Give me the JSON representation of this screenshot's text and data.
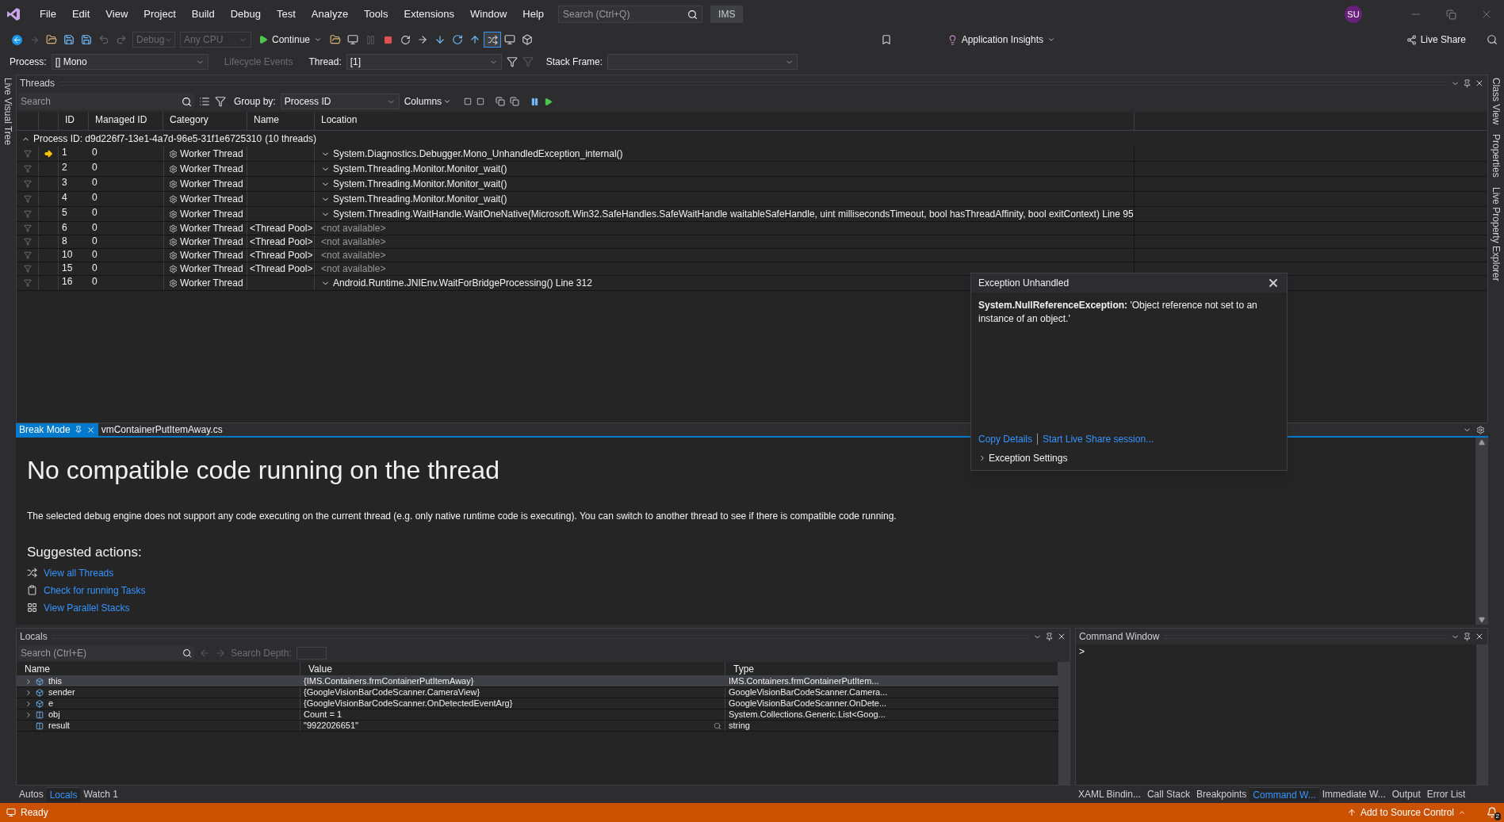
{
  "menu": {
    "items": [
      "File",
      "Edit",
      "View",
      "Project",
      "Build",
      "Debug",
      "Test",
      "Analyze",
      "Tools",
      "Extensions",
      "Window",
      "Help"
    ],
    "search_placeholder": "Search (Ctrl+Q)",
    "solution": "IMS",
    "user_initials": "SU"
  },
  "toolbar": {
    "configuration": "Debug",
    "platform": "Any CPU",
    "continue": "Continue",
    "app_insights": "Application Insights",
    "live_share": "Live Share"
  },
  "debug_location": {
    "process_label": "Process:",
    "process": "[] Mono",
    "lifecycle": "Lifecycle Events",
    "thread_label": "Thread:",
    "thread": "[1]",
    "stack_label": "Stack Frame:"
  },
  "left_strip": [
    "Live Visual Tree"
  ],
  "right_strip": [
    "Class View",
    "Properties",
    "Live Property Explorer"
  ],
  "threads": {
    "title": "Threads",
    "search_placeholder": "Search",
    "group_by_label": "Group by:",
    "group_by": "Process ID",
    "columns_label": "Columns",
    "headers": [
      "ID",
      "Managed ID",
      "Category",
      "Name",
      "Location"
    ],
    "group": {
      "label": "Process ID: d9d226f7-13e1-4a7d-96e5-31f1e6725310",
      "count": "(10 threads)",
      "expanded": true
    },
    "rows": [
      {
        "id": "1",
        "managed_id": "0",
        "category": "Worker Thread",
        "name": "",
        "location": "System.Diagnostics.Debugger.Mono_UnhandledException_internal()",
        "kind": "frame",
        "current": true
      },
      {
        "id": "2",
        "managed_id": "0",
        "category": "Worker Thread",
        "name": "",
        "location": "System.Threading.Monitor.Monitor_wait()",
        "kind": "frame",
        "current": false
      },
      {
        "id": "3",
        "managed_id": "0",
        "category": "Worker Thread",
        "name": "",
        "location": "System.Threading.Monitor.Monitor_wait()",
        "kind": "frame",
        "current": false
      },
      {
        "id": "4",
        "managed_id": "0",
        "category": "Worker Thread",
        "name": "",
        "location": "System.Threading.Monitor.Monitor_wait()",
        "kind": "frame",
        "current": false
      },
      {
        "id": "5",
        "managed_id": "0",
        "category": "Worker Thread",
        "name": "",
        "location": "System.Threading.WaitHandle.WaitOneNative(Microsoft.Win32.SafeHandles.SafeWaitHandle waitableSafeHandle, uint millisecondsTimeout, bool hasThreadAffinity, bool exitContext) Line 95",
        "kind": "frame",
        "current": false
      },
      {
        "id": "6",
        "managed_id": "0",
        "category": "Worker Thread",
        "name": "<Thread Pool>",
        "location": "<not available>",
        "kind": "unavailable",
        "current": false
      },
      {
        "id": "8",
        "managed_id": "0",
        "category": "Worker Thread",
        "name": "<Thread Pool>",
        "location": "<not available>",
        "kind": "unavailable",
        "current": false
      },
      {
        "id": "10",
        "managed_id": "0",
        "category": "Worker Thread",
        "name": "<Thread Pool>",
        "location": "<not available>",
        "kind": "unavailable",
        "current": false
      },
      {
        "id": "15",
        "managed_id": "0",
        "category": "Worker Thread",
        "name": "<Thread Pool>",
        "location": "<not available>",
        "kind": "unavailable",
        "current": false
      },
      {
        "id": "16",
        "managed_id": "0",
        "category": "Worker Thread",
        "name": "",
        "location": "Android.Runtime.JNIEnv.WaitForBridgeProcessing() Line 312",
        "kind": "frame",
        "current": false
      }
    ]
  },
  "exception": {
    "title": "Exception Unhandled",
    "message": "**System.NullReferenceException:** 'Object reference not set to an instance of an object.'",
    "links": [
      "Copy Details",
      "Start Live Share session..."
    ],
    "settings": "Exception Settings"
  },
  "document_tabs": [
    {
      "label": "Break Mode",
      "selected": true
    },
    {
      "label": "vmContainerPutItemAway.cs",
      "selected": false
    }
  ],
  "break_mode": {
    "heading": "No compatible code running on the thread",
    "description": "The selected debug engine does not support any code executing on the current thread (e.g. only native runtime code is executing). You can switch to another thread to see if there is compatible code running.",
    "suggested_title": "Suggested actions:",
    "actions": [
      {
        "label": "View all Threads",
        "kind": "threads"
      },
      {
        "label": "Check for running Tasks",
        "kind": "tasks"
      },
      {
        "label": "View Parallel Stacks",
        "kind": "stacks"
      }
    ]
  },
  "locals": {
    "title": "Locals",
    "search_placeholder": "Search (Ctrl+E)",
    "search_depth_label": "Search Depth:",
    "headers": [
      "Name",
      "Value",
      "Type"
    ],
    "rows": [
      {
        "name": "this",
        "value": "{IMS.Containers.frmContainerPutItemAway}",
        "type": "IMS.Containers.frmContainerPutItem...",
        "kind": "object",
        "expandable": true,
        "selected": true
      },
      {
        "name": "sender",
        "value": "{GoogleVisionBarCodeScanner.CameraView}",
        "type": "GoogleVisionBarCodeScanner.Camera...",
        "kind": "object",
        "expandable": true,
        "selected": false
      },
      {
        "name": "e",
        "value": "{GoogleVisionBarCodeScanner.OnDetectedEventArg}",
        "type": "GoogleVisionBarCodeScanner.OnDete...",
        "kind": "object",
        "expandable": true,
        "selected": false
      },
      {
        "name": "obj",
        "value": "Count = 1",
        "type": "System.Collections.Generic.List<Goog...",
        "kind": "variable",
        "expandable": true,
        "selected": false
      },
      {
        "name": "result",
        "value": "\"9922026651\"",
        "type": "string",
        "kind": "variable",
        "expandable": false,
        "selected": false
      }
    ]
  },
  "locals_tabs": [
    {
      "label": "Autos",
      "selected": false
    },
    {
      "label": "Locals",
      "selected": true
    },
    {
      "label": "Watch 1",
      "selected": false
    }
  ],
  "command_window": {
    "title": "Command Window",
    "prompt": ">"
  },
  "tool_tabs": [
    {
      "label": "XAML Bindin...",
      "selected": false
    },
    {
      "label": "Call Stack",
      "selected": false
    },
    {
      "label": "Breakpoints",
      "selected": false
    },
    {
      "label": "Command W...",
      "selected": true
    },
    {
      "label": "Immediate W...",
      "selected": false
    },
    {
      "label": "Output",
      "selected": false
    },
    {
      "label": "Error List",
      "selected": false
    }
  ],
  "status_bar": {
    "text": "Ready",
    "source_control": "Add to Source Control",
    "notifications": "2"
  }
}
